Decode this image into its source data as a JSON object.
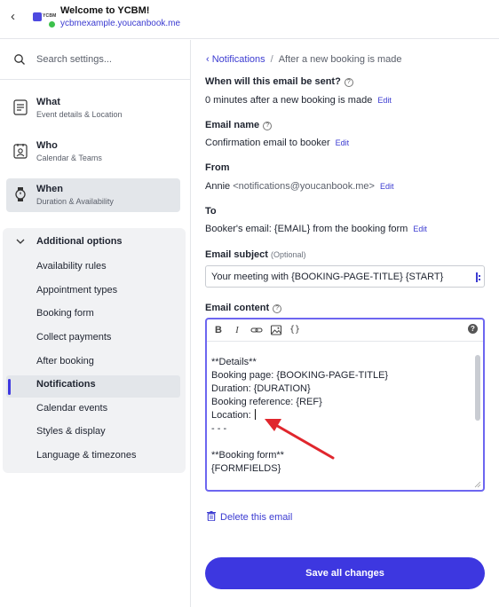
{
  "header": {
    "back_icon": "chevron-left-icon",
    "logo_text": "YCBM",
    "title": "Welcome to YCBM!",
    "url": "ycbmexample.youcanbook.me"
  },
  "sidebar": {
    "search_placeholder": "Search settings...",
    "primary": [
      {
        "label": "What",
        "sub": "Event details & Location",
        "icon": "document-icon"
      },
      {
        "label": "Who",
        "sub": "Calendar & Teams",
        "icon": "person-card-icon"
      },
      {
        "label": "When",
        "sub": "Duration & Availability",
        "icon": "watch-icon",
        "active": true
      }
    ],
    "additional": {
      "title": "Additional options",
      "items": [
        "Availability rules",
        "Appointment types",
        "Booking form",
        "Collect payments",
        "After booking",
        "Notifications",
        "Calendar events",
        "Styles & display",
        "Language & timezones"
      ],
      "active": "Notifications"
    }
  },
  "main": {
    "breadcrumb": {
      "link": "Notifications",
      "current": "After a new booking is made"
    },
    "when_sent": {
      "label": "When will this email be sent?",
      "value": "0 minutes after a new booking is made",
      "edit": "Edit"
    },
    "email_name": {
      "label": "Email name",
      "value": "Confirmation email to booker",
      "edit": "Edit"
    },
    "from": {
      "label": "From",
      "name": "Annie",
      "email": "<notifications@youcanbook.me>",
      "edit": "Edit"
    },
    "to": {
      "label": "To",
      "value": "Booker's email: {EMAIL} from the booking form",
      "edit": "Edit"
    },
    "subject": {
      "label": "Email subject",
      "optional": "(Optional)",
      "value": "Your meeting with {BOOKING-PAGE-TITLE} {START}"
    },
    "content": {
      "label": "Email content",
      "toolbar": [
        "B",
        "I",
        "link-icon",
        "image-icon",
        "{}"
      ],
      "lines": [
        "**Details**",
        "Booking page: {BOOKING-PAGE-TITLE}",
        "Duration: {DURATION}",
        "Booking reference: {REF}",
        "Location: ",
        "- - -",
        "",
        "**Booking form**",
        "{FORMFIELDS}"
      ]
    },
    "delete": "Delete this email",
    "save": "Save all changes"
  },
  "colors": {
    "accent": "#3d37e0",
    "link": "#3b3bd1",
    "annotation_arrow": "#e0262d"
  }
}
